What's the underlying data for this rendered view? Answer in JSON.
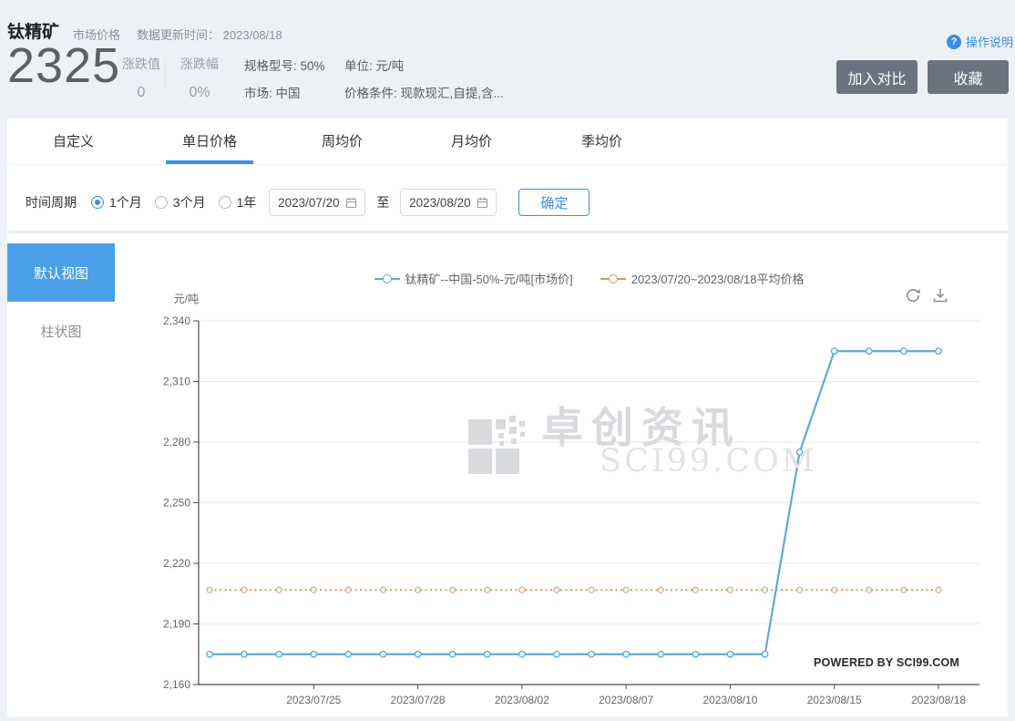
{
  "page": {
    "bg": "#edf1f6",
    "accent": "#3a8ee6"
  },
  "header": {
    "title": "钛精矿",
    "subtitle": "市场价格",
    "update_label": "数据更新时间：",
    "update_date": "2023/08/18",
    "price": "2325",
    "change_value_label": "涨跌值",
    "change_value": "0",
    "change_pct_label": "涨跌幅",
    "change_pct": "0%",
    "spec": "规格型号: 50%",
    "market": "市场: 中国",
    "unit": "单位: 元/吨",
    "condition": "价格条件: 现款现汇,自提,含...",
    "help_label": "操作说明",
    "help_icon": "?",
    "compare_button": "加入对比",
    "favorite_button": "收藏"
  },
  "tabs": [
    {
      "label": "自定义",
      "active": false
    },
    {
      "label": "单日价格",
      "active": true
    },
    {
      "label": "周均价",
      "active": false
    },
    {
      "label": "月均价",
      "active": false
    },
    {
      "label": "季均价",
      "active": false
    }
  ],
  "filter": {
    "period_label": "时间周期",
    "options": [
      {
        "label": "1个月",
        "selected": true
      },
      {
        "label": "3个月",
        "selected": false
      },
      {
        "label": "1年",
        "selected": false
      }
    ],
    "date_from": "2023/07/20",
    "to_label": "至",
    "date_to": "2023/08/20",
    "confirm_label": "确定"
  },
  "sidebar": {
    "items": [
      {
        "label": "默认视图",
        "active": true
      },
      {
        "label": "柱状图",
        "active": false
      }
    ]
  },
  "watermark": {
    "line1": "卓创资讯",
    "line2": "SCI99.COM"
  },
  "powered_by": "POWERED BY SCI99.COM",
  "chart_data": {
    "type": "line",
    "title": "",
    "xlabel": "",
    "ylabel": "元/吨",
    "ylim": [
      2160,
      2340
    ],
    "ytick_step": 30,
    "yticks": [
      2160,
      2190,
      2220,
      2250,
      2280,
      2310,
      2340
    ],
    "grid": true,
    "legend_position": "top",
    "categories": [
      "2023/07/20",
      "2023/07/21",
      "2023/07/24",
      "2023/07/25",
      "2023/07/26",
      "2023/07/27",
      "2023/07/28",
      "2023/07/31",
      "2023/08/01",
      "2023/08/02",
      "2023/08/03",
      "2023/08/04",
      "2023/08/07",
      "2023/08/08",
      "2023/08/09",
      "2023/08/10",
      "2023/08/11",
      "2023/08/14",
      "2023/08/15",
      "2023/08/16",
      "2023/08/17",
      "2023/08/18"
    ],
    "xticks": [
      {
        "index": 3,
        "label": "2023/07/25"
      },
      {
        "index": 6,
        "label": "2023/07/28"
      },
      {
        "index": 9,
        "label": "2023/08/02"
      },
      {
        "index": 12,
        "label": "2023/08/07"
      },
      {
        "index": 15,
        "label": "2023/08/10"
      },
      {
        "index": 18,
        "label": "2023/08/15"
      },
      {
        "index": 21,
        "label": "2023/08/18"
      }
    ],
    "series": [
      {
        "name": "钛精矿--中国-50%-元/吨[市场价]",
        "type": "line",
        "color": "#5dabd8",
        "values": [
          2175,
          2175,
          2175,
          2175,
          2175,
          2175,
          2175,
          2175,
          2175,
          2175,
          2175,
          2175,
          2175,
          2175,
          2175,
          2175,
          2175,
          2275,
          2325,
          2325,
          2325,
          2325
        ]
      },
      {
        "name": "2023/07/20~2023/08/18平均价格",
        "type": "average-line",
        "style": "dotted",
        "color": "#de9560",
        "value": 2206.8
      }
    ]
  }
}
